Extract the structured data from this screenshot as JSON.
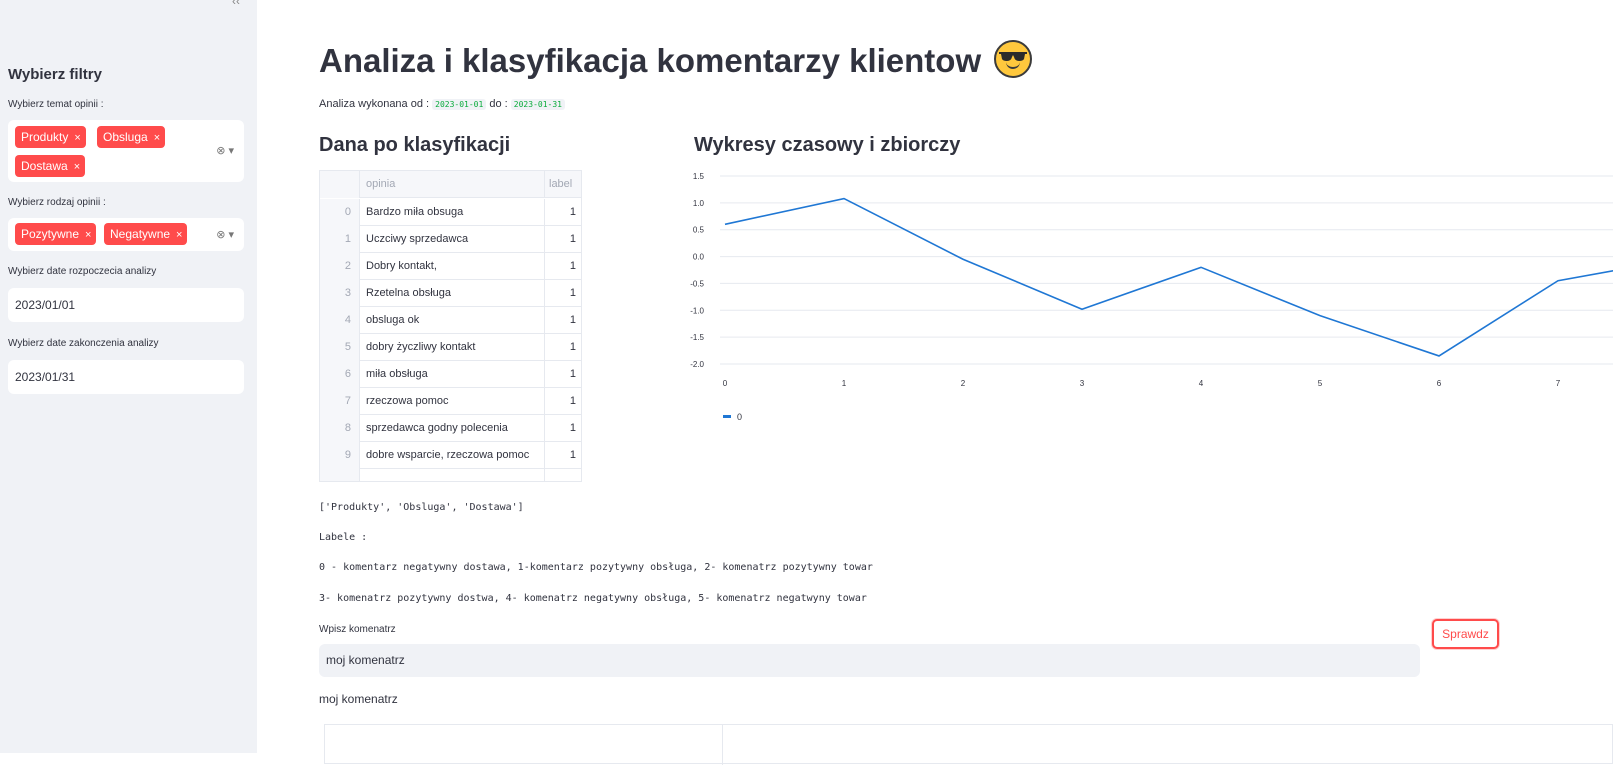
{
  "sidebar": {
    "collapse_glyph": "‹‹",
    "title": "Wybierz filtry",
    "topic_label": "Wybierz temat opinii :",
    "topic_tags": [
      "Produkty",
      "Obsluga",
      "Dostawa"
    ],
    "type_label": "Wybierz rodzaj opinii :",
    "type_tags": [
      "Pozytywne",
      "Negatywne"
    ],
    "remove_glyph": "×",
    "controls_glyph": "⊗ ▾",
    "start_label": "Wybierz date rozpoczecia analizy",
    "start_value": "2023/01/01",
    "end_label": "Wybierz date zakonczenia analizy",
    "end_value": "2023/01/31"
  },
  "main": {
    "title": "Analiza i klasyfikacja komentarzy klientow",
    "range_prefix": "Analiza wykonana od :",
    "range_from": "2023-01-01",
    "range_mid": "do :",
    "range_to": "2023-01-31",
    "table_heading": "Dana po klasyfikacji",
    "chart_heading": "Wykresy czasowy i zbiorczy",
    "table": {
      "columns": [
        "",
        "opinia",
        "label"
      ],
      "rows": [
        {
          "idx": "0",
          "opinia": "Bardzo miła obsuga",
          "label": "1"
        },
        {
          "idx": "1",
          "opinia": "Uczciwy sprzedawca",
          "label": "1"
        },
        {
          "idx": "2",
          "opinia": "Dobry kontakt,",
          "label": "1"
        },
        {
          "idx": "3",
          "opinia": "Rzetelna obsługa",
          "label": "1"
        },
        {
          "idx": "4",
          "opinia": "obsluga ok",
          "label": "1"
        },
        {
          "idx": "5",
          "opinia": "dobry życzliwy kontakt",
          "label": "1"
        },
        {
          "idx": "6",
          "opinia": "miła obsługa",
          "label": "1"
        },
        {
          "idx": "7",
          "opinia": "rzeczowa pomoc",
          "label": "1"
        },
        {
          "idx": "8",
          "opinia": "sprzedawca godny polecenia",
          "label": "1"
        },
        {
          "idx": "9",
          "opinia": "dobre wsparcie, rzeczowa pomoc",
          "label": "1"
        }
      ]
    },
    "topics_list": "['Produkty', 'Obsluga', 'Dostawa']",
    "labels_title": "Labele :",
    "labels_line1": "0 - komentarz negatywny dostawa, 1-komentarz pozytywny obsługa, 2- komenatrz pozytywny towar",
    "labels_line2": "3- komenatrz pozytywny dostwa, 4- komenatrz negatywny obsługa, 5- komenatrz negatwyny towar",
    "input_label": "Wpisz komenatrz",
    "input_value": "moj komenatrz",
    "button_label": "Sprawdz",
    "echo_text": "moj komenatrz"
  },
  "chart_data": {
    "type": "line",
    "x": [
      0,
      1,
      2,
      3,
      4,
      5,
      6,
      7,
      7.5
    ],
    "series": [
      {
        "name": "0",
        "values": [
          0.6,
          1.08,
          -0.05,
          -0.98,
          -0.2,
          -1.1,
          -1.85,
          -0.45,
          -0.25
        ],
        "color": "#1f77d4"
      }
    ],
    "yticks": [
      "1.5",
      "1.0",
      "0.5",
      "0.0",
      "-0.5",
      "-1.0",
      "-1.5",
      "-2.0"
    ],
    "xticks": [
      "0",
      "1",
      "2",
      "3",
      "4",
      "5",
      "6",
      "7"
    ],
    "ylim": [
      -2.0,
      1.5
    ],
    "grid": true,
    "legend": "bottom-left"
  }
}
